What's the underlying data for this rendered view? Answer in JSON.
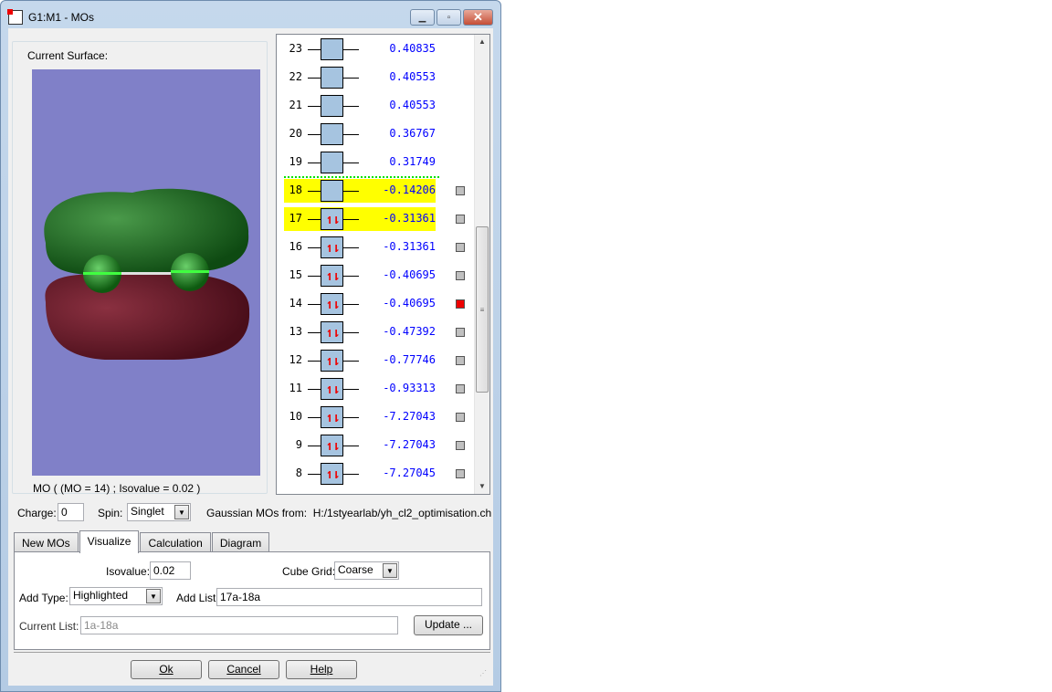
{
  "window": {
    "title": "G1:M1 - MOs"
  },
  "surface": {
    "label": "Current Surface:",
    "mo_caption": "MO ( (MO = 14) ; Isovalue = 0.02 )"
  },
  "orbitals": [
    {
      "n": "23",
      "e": "0.40835",
      "occ": "",
      "hl": false,
      "check": false,
      "checked": false
    },
    {
      "n": "22",
      "e": "0.40553",
      "occ": "",
      "hl": false,
      "check": false,
      "checked": false
    },
    {
      "n": "21",
      "e": "0.40553",
      "occ": "",
      "hl": false,
      "check": false,
      "checked": false
    },
    {
      "n": "20",
      "e": "0.36767",
      "occ": "",
      "hl": false,
      "check": false,
      "checked": false
    },
    {
      "n": "19",
      "e": "0.31749",
      "occ": "",
      "hl": false,
      "check": false,
      "checked": false
    },
    {
      "n": "18",
      "e": "-0.14206",
      "occ": "",
      "hl": true,
      "check": true,
      "checked": false
    },
    {
      "n": "17",
      "e": "-0.31361",
      "occ": "↿⇂",
      "hl": true,
      "check": true,
      "checked": false
    },
    {
      "n": "16",
      "e": "-0.31361",
      "occ": "↿⇂",
      "hl": false,
      "check": true,
      "checked": false
    },
    {
      "n": "15",
      "e": "-0.40695",
      "occ": "↿⇂",
      "hl": false,
      "check": true,
      "checked": false
    },
    {
      "n": "14",
      "e": "-0.40695",
      "occ": "↿⇂",
      "hl": false,
      "check": true,
      "checked": true
    },
    {
      "n": "13",
      "e": "-0.47392",
      "occ": "↿⇂",
      "hl": false,
      "check": true,
      "checked": false
    },
    {
      "n": "12",
      "e": "-0.77746",
      "occ": "↿⇂",
      "hl": false,
      "check": true,
      "checked": false
    },
    {
      "n": "11",
      "e": "-0.93313",
      "occ": "↿⇂",
      "hl": false,
      "check": true,
      "checked": false
    },
    {
      "n": "10",
      "e": "-7.27043",
      "occ": "↿⇂",
      "hl": false,
      "check": true,
      "checked": false
    },
    {
      "n": "9",
      "e": "-7.27043",
      "occ": "↿⇂",
      "hl": false,
      "check": true,
      "checked": false
    },
    {
      "n": "8",
      "e": "-7.27045",
      "occ": "↿⇂",
      "hl": false,
      "check": true,
      "checked": false
    }
  ],
  "controls": {
    "charge_label": "Charge:",
    "charge": "0",
    "spin_label": "Spin:",
    "spin": "Singlet",
    "source_label": "Gaussian MOs from:",
    "source": "H:/1styearlab/yh_cl2_optimisation.ch"
  },
  "tabs": [
    "New MOs",
    "Visualize",
    "Calculation",
    "Diagram"
  ],
  "visualize": {
    "isovalue_label": "Isovalue:",
    "isovalue": "0.02",
    "cube_grid_label": "Cube Grid:",
    "cube_grid": "Coarse",
    "add_type_label": "Add Type:",
    "add_type": "Highlighted",
    "add_list_label": "Add List:",
    "add_list": "17a-18a",
    "current_list_label": "Current List:",
    "current_list": "1a-18a",
    "update": "Update ..."
  },
  "buttons": {
    "ok": "Ok",
    "cancel": "Cancel",
    "help": "Help"
  },
  "colors": {
    "highlight": "#ffff00",
    "energy": "#0000ff",
    "viewport": "#8080c8"
  }
}
